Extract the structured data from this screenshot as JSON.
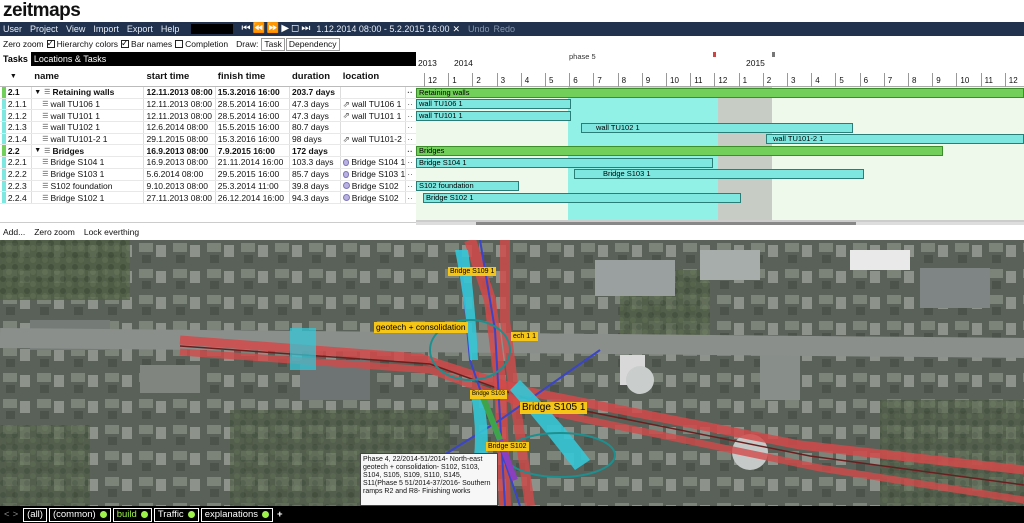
{
  "app": {
    "logo": "zeitmaps"
  },
  "menubar": {
    "items": [
      "User",
      "Project",
      "View",
      "Import",
      "Export",
      "Help"
    ],
    "transport": [
      "⏮",
      "⏪",
      "⏩",
      "▶",
      "◻",
      "⏭"
    ],
    "date_range": "1.12.2014 08:00 - 5.2.2015 16:00",
    "close": "✕",
    "undo": "Undo",
    "redo": "Redo"
  },
  "options": {
    "zero_zoom": "Zero zoom",
    "hierarchy_colors": "Hierarchy colors",
    "bar_names": "Bar names",
    "completion": "Completion",
    "draw_label": "Draw:",
    "draw_task": "Task",
    "draw_dependency": "Dependency"
  },
  "tabs": [
    "Tasks",
    "Locations & Tasks"
  ],
  "table": {
    "sort_icon": "▼",
    "headers": {
      "name": "name",
      "start": "start time",
      "finish": "finish time",
      "duration": "duration",
      "location": "location"
    },
    "rows": [
      {
        "id": "2.1",
        "name": "Retaining walls",
        "start": "12.11.2013 08:00",
        "finish": "15.3.2016 16:00",
        "duration": "203.7 days",
        "location": "",
        "group": true,
        "color": "#72d05a"
      },
      {
        "id": "2.1.1",
        "name": "wall TU106 1",
        "start": "12.11.2013 08:00",
        "finish": "28.5.2014 16:00",
        "duration": "47.3 days",
        "location": "wall TU106 1",
        "group": false,
        "color": "#7ee8e0"
      },
      {
        "id": "2.1.2",
        "name": "wall TU101 1",
        "start": "12.11.2013 08:00",
        "finish": "28.5.2014 16:00",
        "duration": "47.3 days",
        "location": "wall TU101 1",
        "group": false,
        "color": "#7ee8e0"
      },
      {
        "id": "2.1.3",
        "name": "wall TU102 1",
        "start": "12.6.2014 08:00",
        "finish": "15.5.2015 16:00",
        "duration": "80.7 days",
        "location": "",
        "group": false,
        "color": "#7ee8e0"
      },
      {
        "id": "2.1.4",
        "name": "wall TU101-2 1",
        "start": "29.1.2015 08:00",
        "finish": "15.3.2016 16:00",
        "duration": "98 days",
        "location": "wall TU101-2 1",
        "group": false,
        "color": "#7ee8e0"
      },
      {
        "id": "2.2",
        "name": "Bridges",
        "start": "16.9.2013 08:00",
        "finish": "7.9.2015 16:00",
        "duration": "172 days",
        "location": "",
        "group": true,
        "color": "#72d05a"
      },
      {
        "id": "2.2.1",
        "name": "Bridge S104 1",
        "start": "16.9.2013 08:00",
        "finish": "21.11.2014 16:00",
        "duration": "103.3 days",
        "location": "Bridge S104 1",
        "group": false,
        "color": "#7ee8e0"
      },
      {
        "id": "2.2.2",
        "name": "Bridge S103 1",
        "start": "5.6.2014 08:00",
        "finish": "29.5.2015 16:00",
        "duration": "85.7 days",
        "location": "Bridge S103 1",
        "group": false,
        "color": "#7ee8e0"
      },
      {
        "id": "2.2.3",
        "name": "S102 foundation",
        "start": "9.10.2013 08:00",
        "finish": "25.3.2014 11:00",
        "duration": "39.8 days",
        "location": "Bridge S102",
        "group": false,
        "color": "#7ee8e0"
      },
      {
        "id": "2.2.4",
        "name": "Bridge S102 1",
        "start": "27.11.2013 08:00",
        "finish": "26.12.2014 16:00",
        "duration": "94.3 days",
        "location": "Bridge S102",
        "group": false,
        "color": "#7ee8e0"
      }
    ]
  },
  "gantt": {
    "years": [
      "2013",
      "2014",
      "2015"
    ],
    "months": [
      "12",
      "1",
      "2",
      "3",
      "4",
      "5",
      "6",
      "7",
      "8",
      "9",
      "10",
      "11",
      "12",
      "1",
      "2",
      "3",
      "4",
      "5",
      "6",
      "7",
      "8",
      "9",
      "10",
      "11",
      "12"
    ],
    "phase_label": "phase 5",
    "bar_labels": [
      "Retaining walls",
      "wall TU106 1",
      "wall TU101 1",
      "wall TU102 1",
      "wall TU101-2 1",
      "Bridges",
      "Bridge S104 1",
      "Bridge S103 1",
      "S102 foundation",
      "Bridge S102 1"
    ]
  },
  "tablebar": {
    "add": "Add...",
    "zero_zoom": "Zero zoom",
    "lock": "Lock everthing"
  },
  "map": {
    "labels": {
      "bridge_s109": "Bridge S109 1",
      "geotech": "geotech + consolidation",
      "tech": "ech 1 1",
      "bridge_s105": "Bridge S105 1",
      "bridge_s103": "Bridge S103",
      "bridge_s102": "Bridge S102"
    },
    "tooltip": "Phase 4, 22/2014-51/2014- North-east geotech + consolidation- S102, S103, S104, S105, S109, S110, S145, S11(Phase 5 51/2014-37/2016- Southern ramps R2 and R8- Finishing works"
  },
  "layerbar": {
    "nav_prev": "<",
    "nav_next": ">",
    "layers": [
      {
        "label": "(all)",
        "dot": "",
        "selected": false
      },
      {
        "label": "(common)",
        "dot": "#9ef14a",
        "selected": false
      },
      {
        "label": "build",
        "dot": "#9ef14a",
        "selected": true
      },
      {
        "label": "Traffic",
        "dot": "#9ef14a",
        "selected": false
      },
      {
        "label": "explanations",
        "dot": "#9ef14a",
        "selected": false
      }
    ],
    "add": "+"
  }
}
